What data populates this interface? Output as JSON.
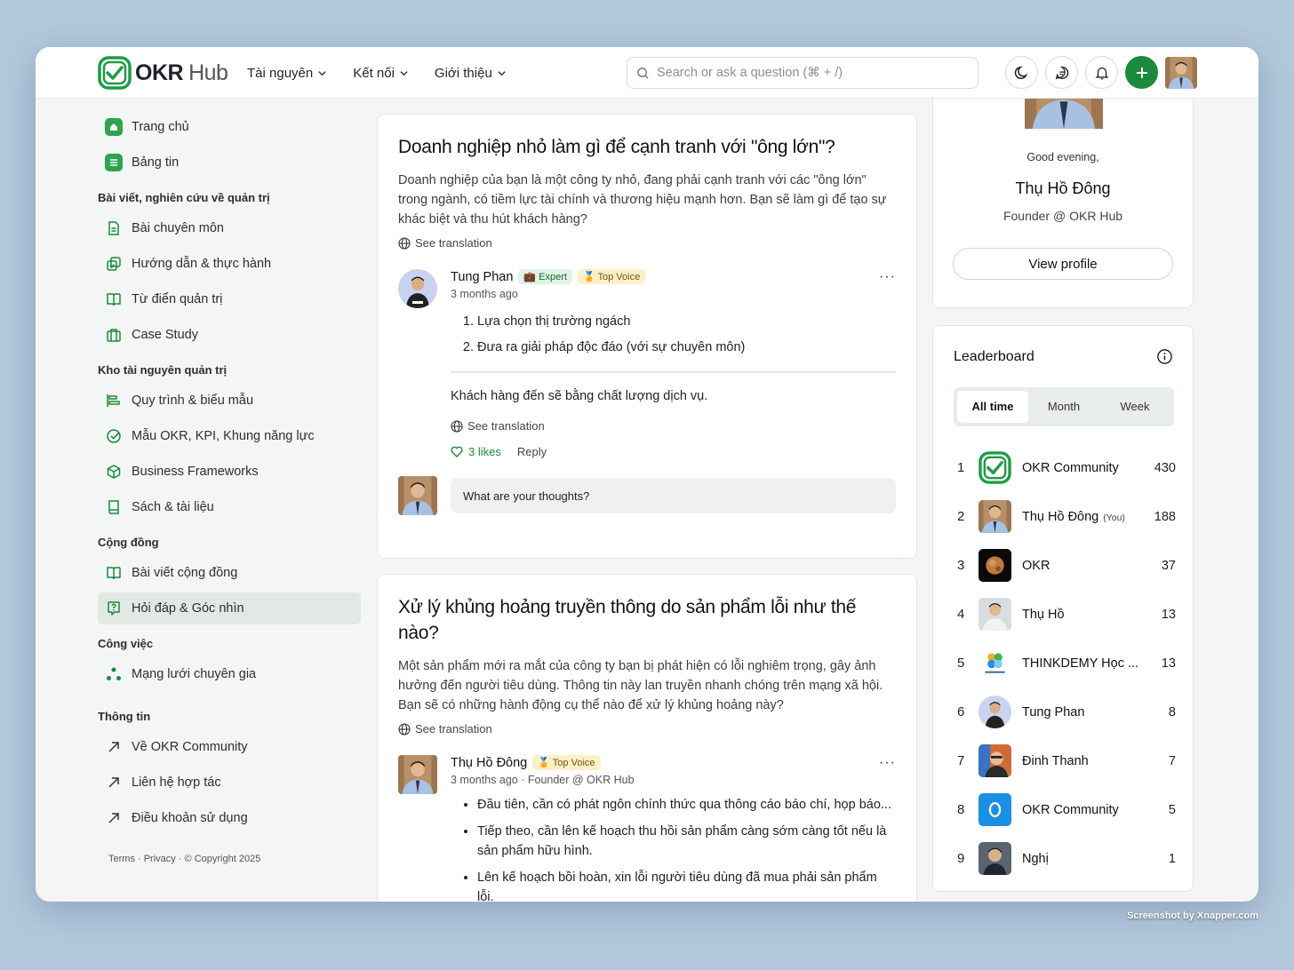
{
  "brand": {
    "name": "OKR",
    "suffix": "Hub",
    "accent": "#1a8a3c"
  },
  "topnav": [
    {
      "label": "Tài nguyên"
    },
    {
      "label": "Kết nối"
    },
    {
      "label": "Giới thiệu"
    }
  ],
  "search": {
    "placeholder": "Search or ask a question (⌘ + /)"
  },
  "sidebar": {
    "home": "Trang chủ",
    "feed": "Bảng tin",
    "section1": "Bài viết, nghiên cứu về quản trị",
    "s1_items": [
      "Bài chuyên môn",
      "Hướng dẫn & thực hành",
      "Từ điển quản trị",
      "Case Study"
    ],
    "section2": "Kho tài nguyên quản trị",
    "s2_items": [
      "Quy trình & biểu mẫu",
      "Mẫu OKR, KPI, Khung năng lực",
      "Business Frameworks",
      "Sách & tài liệu"
    ],
    "section3": "Cộng đồng",
    "s3_items": [
      "Bài viết cộng đồng",
      "Hỏi đáp & Góc nhìn"
    ],
    "section4": "Công việc",
    "s4_items": [
      "Mạng lưới chuyên gia"
    ],
    "section5": "Thông tin",
    "s5_items": [
      "Về OKR Community",
      "Liên hệ hợp tác",
      "Điều khoản sử dụng"
    ],
    "footer": "Terms · Privacy · © Copyright 2025"
  },
  "posts": [
    {
      "title": "Doanh nghiệp nhỏ làm gì để cạnh tranh với \"ông lớn\"?",
      "body": "Doanh nghiệp của bạn là một công ty nhỏ, đang phải cạnh tranh với các \"ông lớn\" trong ngành, có tiềm lực tài chính và thương hiệu mạnh hơn. Bạn sẽ làm gì để tạo sự khác biệt và thu hút khách hàng?",
      "see_translation": "See translation",
      "answer": {
        "author": "Tung Phan",
        "badge_expert": "💼 Expert",
        "badge_voice": "🏅 Top Voice",
        "meta": "3 months ago",
        "list": [
          "Lựa chọn thị trường ngách",
          "Đưa ra giải pháp độc đáo (với sự chuyên môn)"
        ],
        "text": "Khách hàng đến sẽ bằng chất lượng dịch vụ.",
        "see_translation": "See translation",
        "likes": "3 likes",
        "reply": "Reply"
      },
      "comment_placeholder": "What are your thoughts?"
    },
    {
      "title": "Xử lý khủng hoảng truyền thông do sản phẩm lỗi như thế nào?",
      "body": "Một sản phẩm mới ra mắt của công ty bạn bị phát hiện có lỗi nghiêm trọng, gây ảnh hưởng đến người tiêu dùng. Thông tin này lan truyền nhanh chóng trên mạng xã hội. Bạn sẽ có những hành động cụ thể nào để xử lý khủng hoảng này?",
      "see_translation": "See translation",
      "answer": {
        "author": "Thụ Hồ Đông",
        "badge_voice": "🏅 Top Voice",
        "meta": "3 months ago · Founder @ OKR Hub",
        "list": [
          "Đầu tiên, cần có phát ngôn chính thức qua thông cáo báo chí, họp báo...",
          "Tiếp theo, cần lên kế hoạch thu hồi sản phẩm càng sớm càng tốt nếu là sản phẩm hữu hình.",
          "Lên kế hoạch bồi hoàn, xin lỗi người tiêu dùng đã mua phải sản phẩm lỗi."
        ]
      }
    }
  ],
  "profile": {
    "greeting": "Good evening,",
    "name": "Thụ Hồ Đông",
    "role": "Founder @ OKR Hub",
    "button": "View profile"
  },
  "leaderboard": {
    "title": "Leaderboard",
    "tabs": [
      "All time",
      "Month",
      "Week"
    ],
    "you_label": "(You)",
    "rows": [
      {
        "rank": "1",
        "name": "OKR Community",
        "score": "430"
      },
      {
        "rank": "2",
        "name": "Thụ Hồ Đông",
        "score": "188"
      },
      {
        "rank": "3",
        "name": "OKR",
        "score": "37"
      },
      {
        "rank": "4",
        "name": "Thụ Hồ",
        "score": "13"
      },
      {
        "rank": "5",
        "name": "THINKDEMY Học ...",
        "score": "13"
      },
      {
        "rank": "6",
        "name": "Tung Phan",
        "score": "8"
      },
      {
        "rank": "7",
        "name": "Đinh Thanh",
        "score": "7"
      },
      {
        "rank": "8",
        "name": "OKR Community",
        "score": "5"
      },
      {
        "rank": "9",
        "name": "Nghị",
        "score": "1"
      }
    ]
  },
  "credit": "Screenshot by Xnapper.com"
}
